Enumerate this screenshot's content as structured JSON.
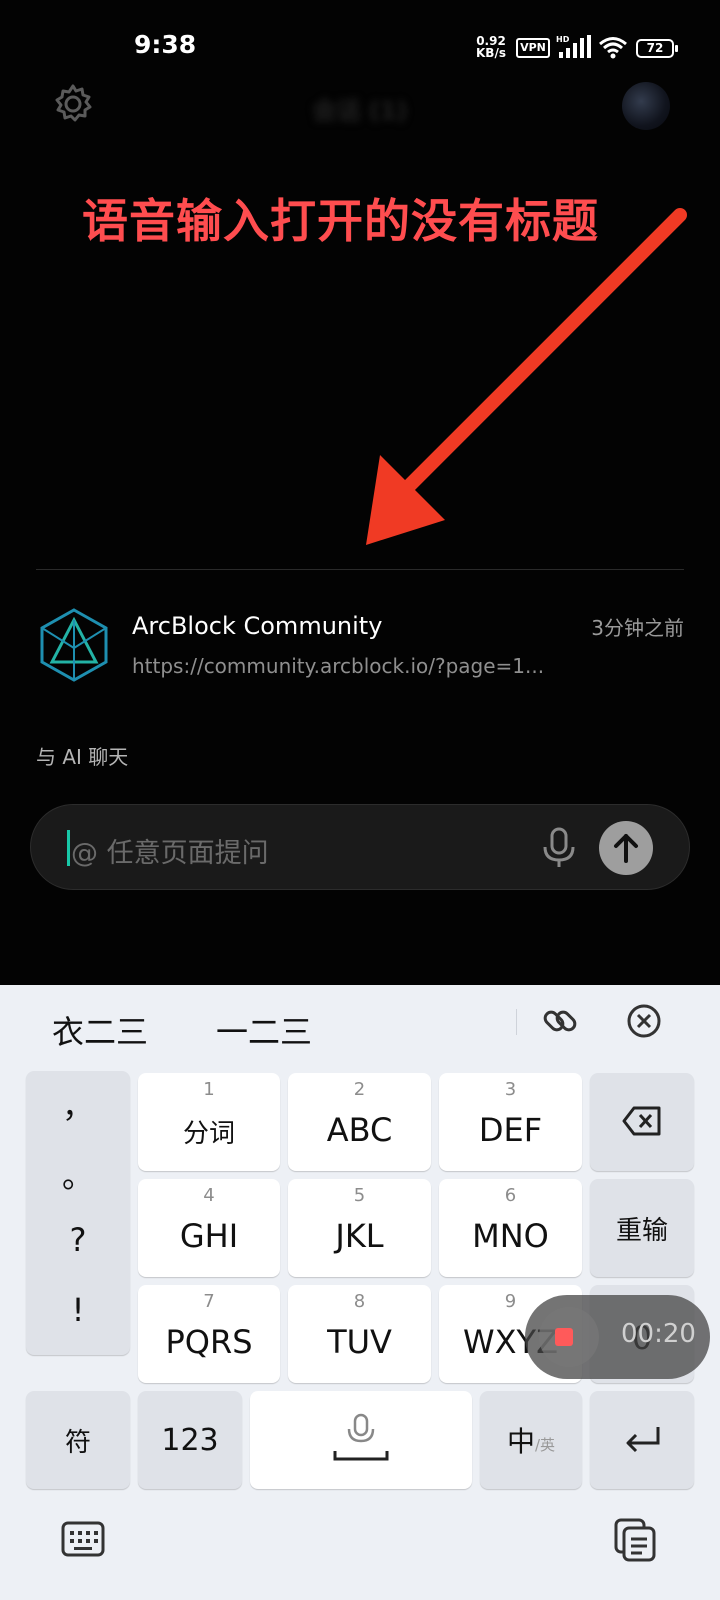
{
  "status_bar": {
    "time": "9:38",
    "net_speed_value": "0.92",
    "net_speed_unit": "KB/s",
    "vpn": "VPN",
    "signal_label": "HD",
    "battery": "72"
  },
  "header": {
    "title": "会话 (1)"
  },
  "annotation": {
    "text": "语音输入打开的没有标题",
    "color": "#ff4d4f"
  },
  "history": {
    "items": [
      {
        "title": "ArcBlock Community",
        "url": "https://community.arcblock.io/?page=1...",
        "time": "3分钟之前"
      }
    ]
  },
  "chat": {
    "label": "与 AI 聊天",
    "placeholder": "@ 任意页面提问"
  },
  "keyboard": {
    "candidates": [
      "衣二三",
      "一二三"
    ],
    "punctuation": [
      "，",
      "。",
      "?",
      "!"
    ],
    "keys": {
      "k1": {
        "num": "1",
        "label": "分词"
      },
      "k2": {
        "num": "2",
        "label": "ABC"
      },
      "k3": {
        "num": "3",
        "label": "DEF"
      },
      "k4": {
        "num": "4",
        "label": "GHI"
      },
      "k5": {
        "num": "5",
        "label": "JKL"
      },
      "k6": {
        "num": "6",
        "label": "MNO"
      },
      "k7": {
        "num": "7",
        "label": "PQRS"
      },
      "k8": {
        "num": "8",
        "label": "TUV"
      },
      "k9": {
        "num": "9",
        "label": "WXYZ"
      },
      "k0": {
        "num": "0"
      }
    },
    "reinput": "重输",
    "symbols": "符",
    "numbers": "123",
    "lang_main": "中",
    "lang_sub": "/英",
    "recording_time": "00:20"
  },
  "colors": {
    "accent_caret": "#18c8a8",
    "record_stop": "#ff5a5a",
    "arrow": "#f03a24"
  }
}
